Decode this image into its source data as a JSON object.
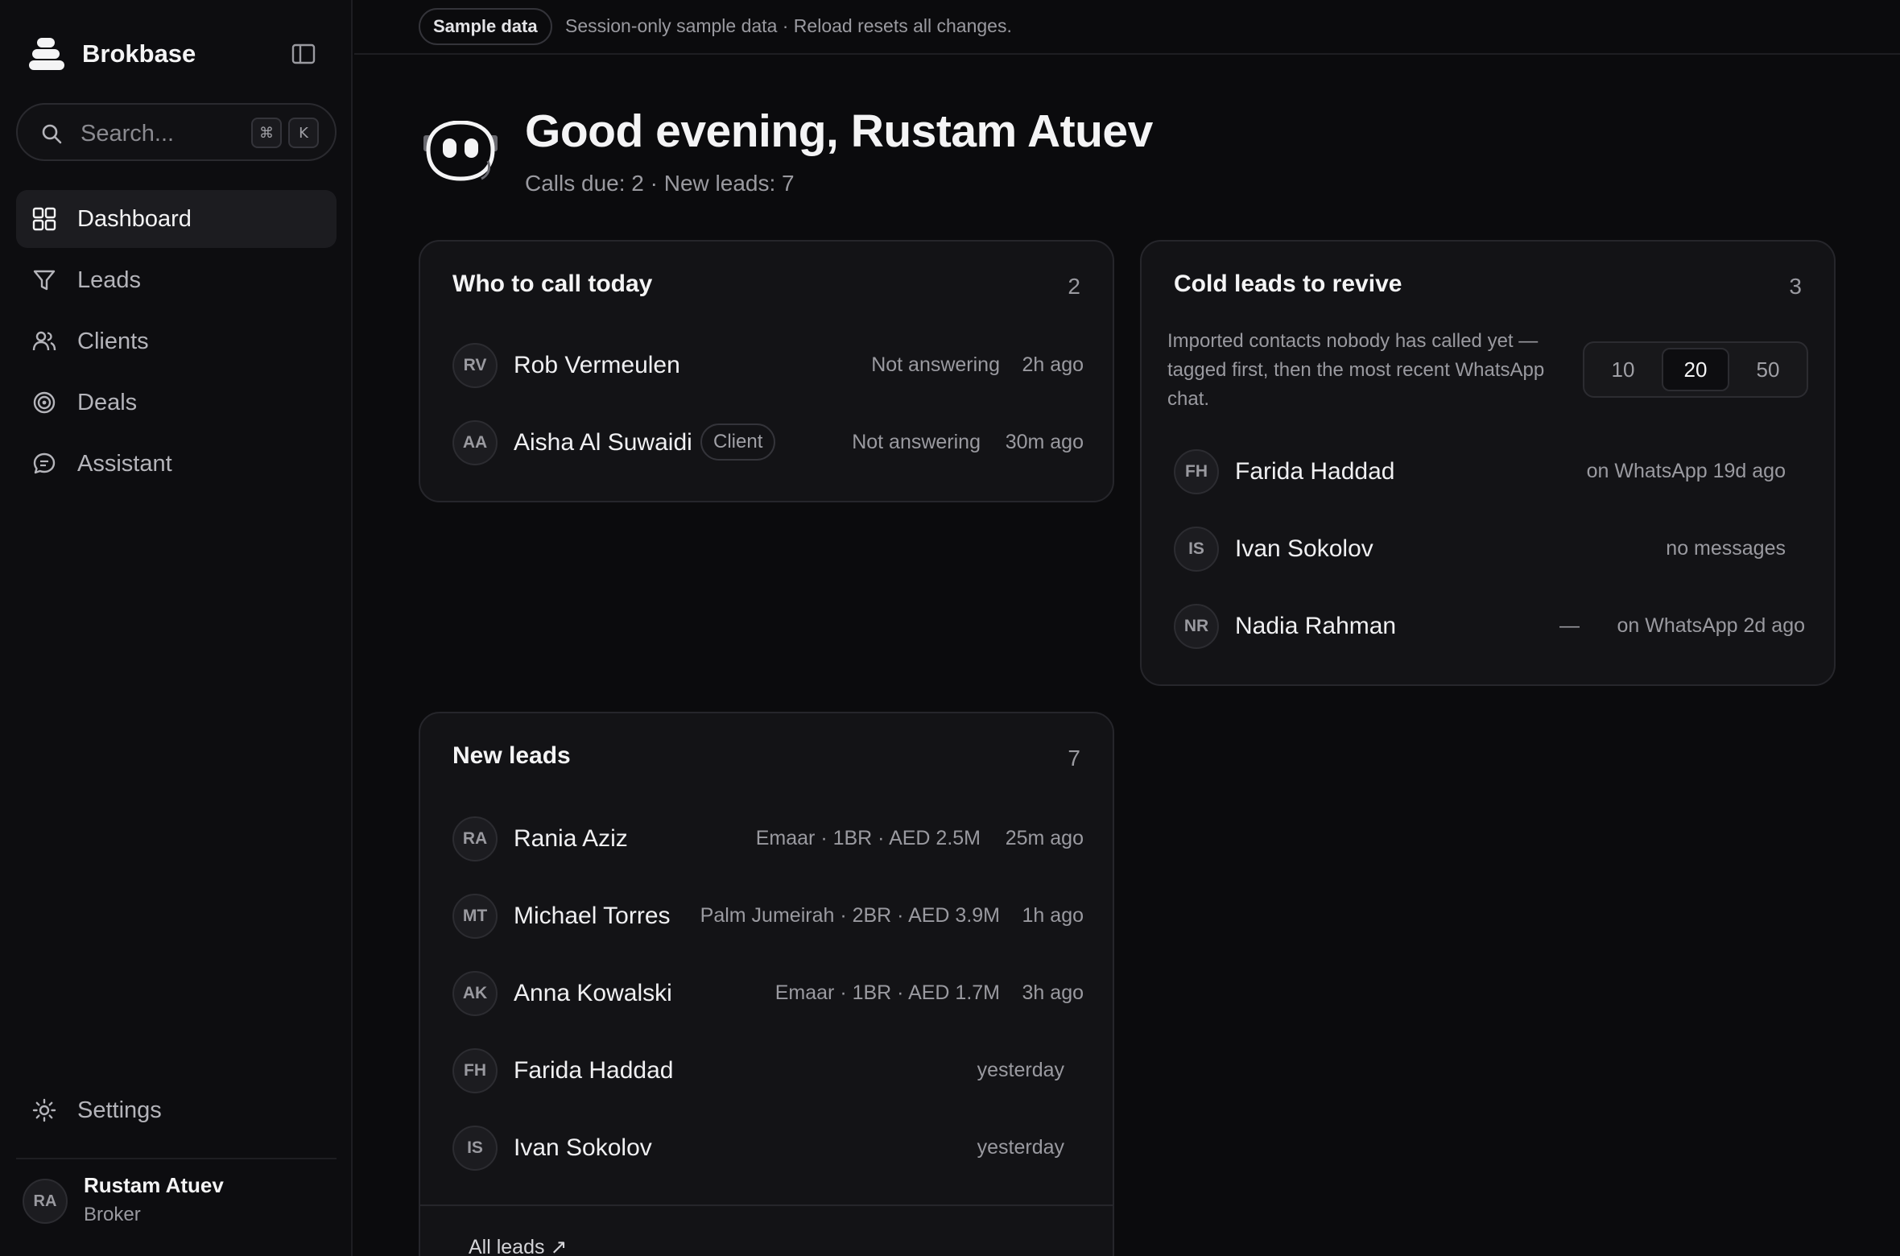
{
  "app": {
    "name": "Brokbase"
  },
  "search": {
    "placeholder": "Search...",
    "shortcut_mod": "⌘",
    "shortcut_key": "K"
  },
  "nav": {
    "items": [
      {
        "label": "Dashboard",
        "icon": "dashboard-grid-icon",
        "active": true
      },
      {
        "label": "Leads",
        "icon": "filter-funnel-icon",
        "active": false
      },
      {
        "label": "Clients",
        "icon": "users-icon",
        "active": false
      },
      {
        "label": "Deals",
        "icon": "target-icon",
        "active": false
      },
      {
        "label": "Assistant",
        "icon": "chat-bubble-icon",
        "active": false
      }
    ],
    "settings": "Settings"
  },
  "user": {
    "initials": "RA",
    "name": "Rustam Atuev",
    "role": "Broker"
  },
  "banner": {
    "badge": "Sample data",
    "text": "Session-only sample data · Reload resets all changes."
  },
  "greeting": {
    "title": "Good evening, Rustam Atuev",
    "subtitle": "Calls due: 2 · New leads: 7"
  },
  "call_today": {
    "title": "Who to call today",
    "count": "2",
    "rows": [
      {
        "initials": "RV",
        "name": "Rob Vermeulen",
        "tag": "",
        "status": "Not answering",
        "time": "2h ago"
      },
      {
        "initials": "AA",
        "name": "Aisha Al Suwaidi",
        "tag": "Client",
        "status": "Not answering",
        "time": "30m ago"
      }
    ]
  },
  "cold_leads": {
    "title": "Cold leads to revive",
    "count": "3",
    "description": "Imported contacts nobody has called yet — tagged first, then the most recent WhatsApp chat.",
    "limits": [
      "10",
      "20",
      "50"
    ],
    "selected_limit": "20",
    "rows": [
      {
        "initials": "FH",
        "name": "Farida Haddad",
        "dash": "",
        "meta": "on WhatsApp 19d ago"
      },
      {
        "initials": "IS",
        "name": "Ivan Sokolov",
        "dash": "",
        "meta": "no messages"
      },
      {
        "initials": "NR",
        "name": "Nadia Rahman",
        "dash": "—",
        "meta": "on WhatsApp 2d ago"
      }
    ]
  },
  "new_leads": {
    "title": "New leads",
    "count": "7",
    "rows": [
      {
        "initials": "RA",
        "name": "Rania Aziz",
        "detail": "Emaar · 1BR · AED 2.5M",
        "time": "25m ago"
      },
      {
        "initials": "MT",
        "name": "Michael Torres",
        "detail": "Palm Jumeirah · 2BR · AED 3.9M",
        "time": "1h ago"
      },
      {
        "initials": "AK",
        "name": "Anna Kowalski",
        "detail": "Emaar · 1BR · AED 1.7M",
        "time": "3h ago"
      },
      {
        "initials": "FH",
        "name": "Farida Haddad",
        "detail": "",
        "time": "yesterday"
      },
      {
        "initials": "IS",
        "name": "Ivan Sokolov",
        "detail": "",
        "time": "yesterday"
      }
    ],
    "footer_link": "All leads ↗"
  },
  "colors": {
    "background": "#0b0b0d",
    "sidebar": "#0d0d10",
    "card": "#131316",
    "text_primary": "#f4f4f5",
    "text_muted": "#9a9aa0"
  }
}
